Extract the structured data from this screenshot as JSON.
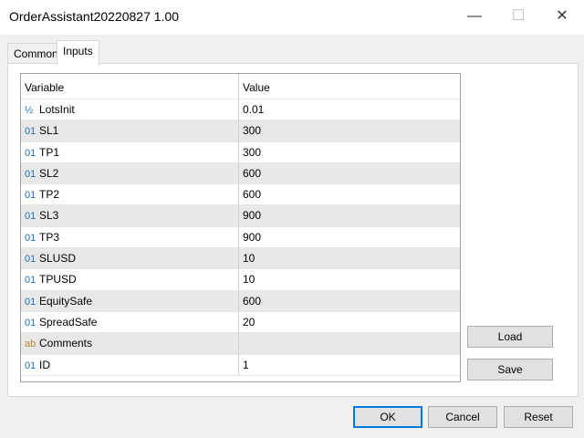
{
  "window": {
    "title": "OrderAssistant20220827 1.00",
    "minimize": "—",
    "maximize": "☐",
    "close": "✕"
  },
  "tabs": [
    {
      "label": "Common"
    },
    {
      "label": "Inputs"
    }
  ],
  "table": {
    "headers": [
      "Variable",
      "Value"
    ],
    "rows": [
      {
        "icon": "½",
        "type": "double",
        "name": "LotsInit",
        "value": "0.01"
      },
      {
        "icon": "01",
        "type": "int",
        "name": "SL1",
        "value": "300"
      },
      {
        "icon": "01",
        "type": "int",
        "name": "TP1",
        "value": "300"
      },
      {
        "icon": "01",
        "type": "int",
        "name": "SL2",
        "value": "600"
      },
      {
        "icon": "01",
        "type": "int",
        "name": "TP2",
        "value": "600"
      },
      {
        "icon": "01",
        "type": "int",
        "name": "SL3",
        "value": "900"
      },
      {
        "icon": "01",
        "type": "int",
        "name": "TP3",
        "value": "900"
      },
      {
        "icon": "01",
        "type": "int",
        "name": "SLUSD",
        "value": "10"
      },
      {
        "icon": "01",
        "type": "int",
        "name": "TPUSD",
        "value": "10"
      },
      {
        "icon": "01",
        "type": "int",
        "name": "EquitySafe",
        "value": "600"
      },
      {
        "icon": "01",
        "type": "int",
        "name": "SpreadSafe",
        "value": "20"
      },
      {
        "icon": "ab",
        "type": "string",
        "name": "Comments",
        "value": ""
      },
      {
        "icon": "01",
        "type": "int",
        "name": "ID",
        "value": "1"
      }
    ]
  },
  "buttons": {
    "load": "Load",
    "save": "Save",
    "ok": "OK",
    "cancel": "Cancel",
    "reset": "Reset"
  }
}
